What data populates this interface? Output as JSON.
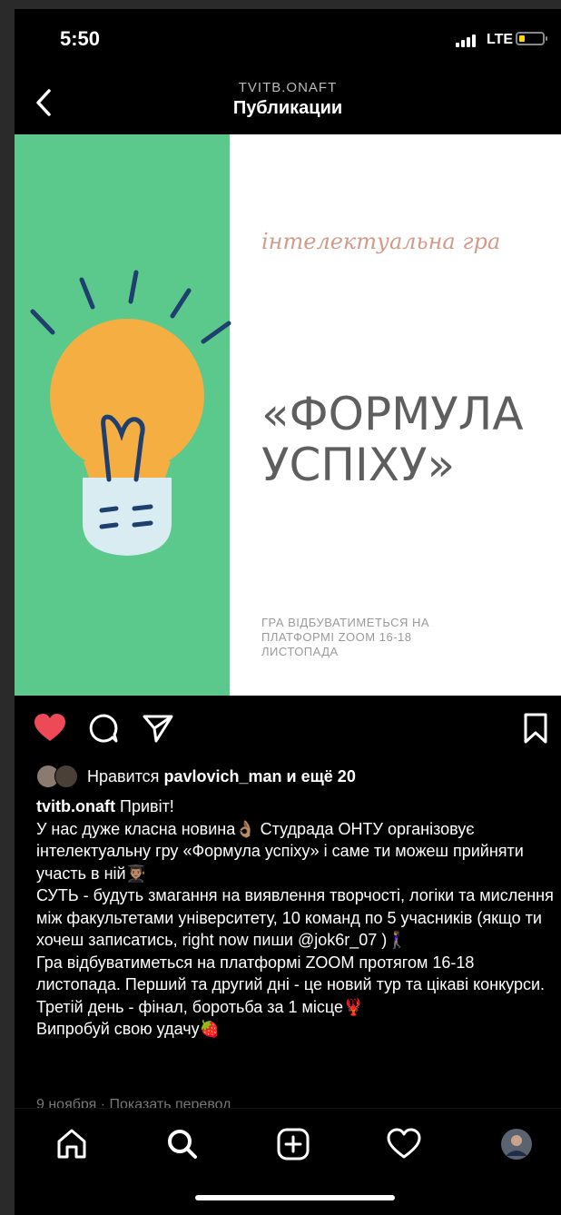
{
  "status_bar": {
    "time": "5:50",
    "network": "LTE",
    "battery_level": 0.2,
    "signal_bars": 4
  },
  "header": {
    "account": "TVITB.ONAFT",
    "title": "Публикации"
  },
  "post": {
    "image": {
      "subtitle": "інтелектуальна гра",
      "title_line1": "«ФОРМУЛА",
      "title_line2": "УСПІХУ»",
      "note": "ГРА ВІДБУВАТИМЕТЬСЯ НА ПЛАТФОРМІ ZOOM 16-18 ЛИСТОПАДА",
      "colors": {
        "left_panel": "#5bc98b",
        "bulb": "#f5ae42",
        "bulb_base": "#d9ecf2",
        "rays": "#1f3f6e"
      }
    },
    "liked": true,
    "likes": {
      "prefix": "Нравится",
      "user": "pavlovich_man",
      "suffix": "и ещё 20"
    },
    "caption": {
      "username": "tvitb.onaft",
      "first": " Привіт!",
      "lines": [
        "У нас дуже класна новина👌🏽 Студрада ОНТУ організовує інтелектуальну гру «Формула успіху» і саме ти можеш прийняти участь в ній👨🏽‍🎓",
        "СУТЬ - будуть змагання на виявлення творчості, логіки та мислення між факультетами університету, 10 команд по 5 учасників (якщо ти хочеш записатись, right now пиши @jok6r_07 )🚶🏽‍♀️",
        "Гра відбуватиметься на платформі ZOOM протягом 16-18 листопада. Перший та другий дні - це новий тур та цікаві конкурси. Третій день - фінал, боротьба за 1 місце🦞",
        "Випробуй свою удачу🍓"
      ]
    },
    "footer_partial": "9 ноября · Показать перевод"
  },
  "icons": {
    "back": "chevron-left-icon",
    "like": "heart-filled-icon",
    "comment": "comment-icon",
    "share": "paper-plane-icon",
    "save": "bookmark-icon",
    "tabs": [
      "home-icon",
      "search-icon",
      "add-post-icon",
      "activity-heart-icon",
      "profile-avatar"
    ]
  },
  "colors": {
    "like_red": "#ed4956",
    "background": "#000000"
  }
}
